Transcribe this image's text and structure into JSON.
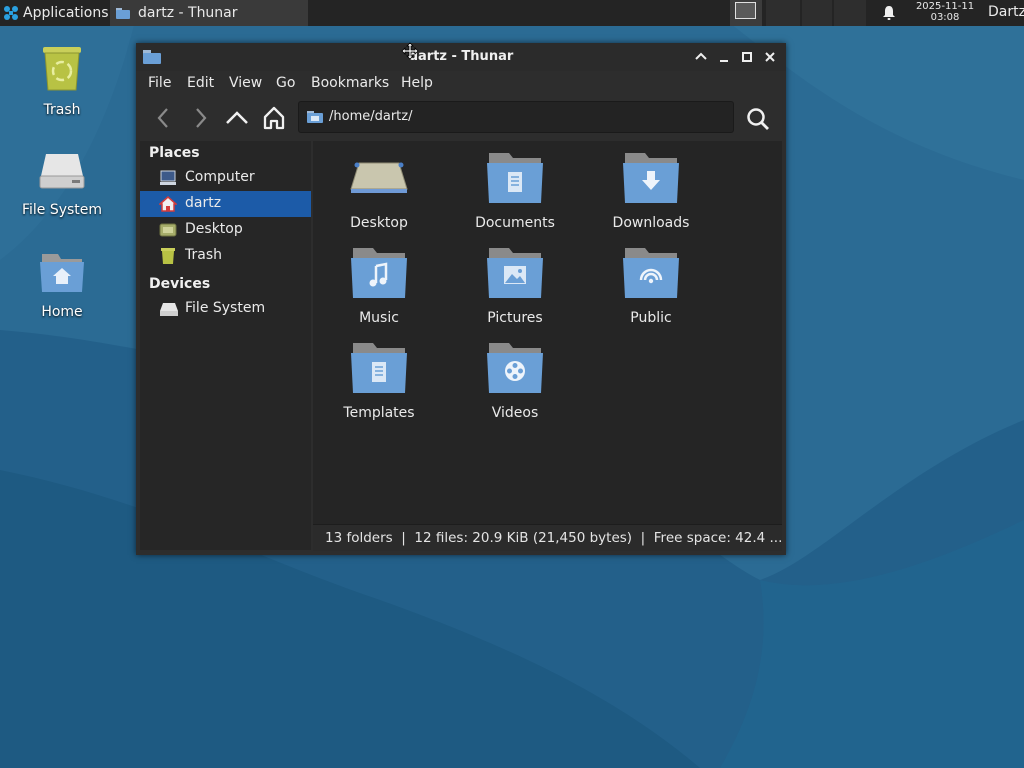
{
  "panel": {
    "app_menu": "Applications",
    "app_menu_sep": "≡",
    "task_title": "dartz - Thunar",
    "clock_date": "2025-11-11",
    "clock_time": "03:08",
    "user": "Dartz"
  },
  "desktop": {
    "icons": [
      {
        "label": "Trash"
      },
      {
        "label": "File System"
      },
      {
        "label": "Home"
      }
    ]
  },
  "window": {
    "title": "dartz - Thunar",
    "menu": [
      "File",
      "Edit",
      "View",
      "Go",
      "Bookmarks",
      "Help"
    ],
    "path": "/home/dartz/",
    "sidebar": {
      "places_heading": "Places",
      "places": [
        {
          "label": "Computer",
          "icon": "computer-icon"
        },
        {
          "label": "dartz",
          "icon": "home-icon",
          "selected": true
        },
        {
          "label": "Desktop",
          "icon": "desktop-icon"
        },
        {
          "label": "Trash",
          "icon": "trash-icon"
        }
      ],
      "devices_heading": "Devices",
      "devices": [
        {
          "label": "File System",
          "icon": "drive-icon"
        }
      ]
    },
    "items": [
      {
        "label": "Desktop",
        "icon": "desktop-folder-icon"
      },
      {
        "label": "Documents",
        "icon": "documents-folder-icon"
      },
      {
        "label": "Downloads",
        "icon": "downloads-folder-icon"
      },
      {
        "label": "Music",
        "icon": "music-folder-icon"
      },
      {
        "label": "Pictures",
        "icon": "pictures-folder-icon"
      },
      {
        "label": "Public",
        "icon": "public-folder-icon"
      },
      {
        "label": "Templates",
        "icon": "templates-folder-icon"
      },
      {
        "label": "Videos",
        "icon": "videos-folder-icon"
      }
    ],
    "status": "13 folders  |  12 files: 20.9 KiB (21,450 bytes)  |  Free space: 42.4 ..."
  },
  "colors": {
    "accent": "#1c5ba8",
    "folder": "#6a9fd6",
    "panel": "#242424",
    "window_bg": "#2d2d2d"
  }
}
